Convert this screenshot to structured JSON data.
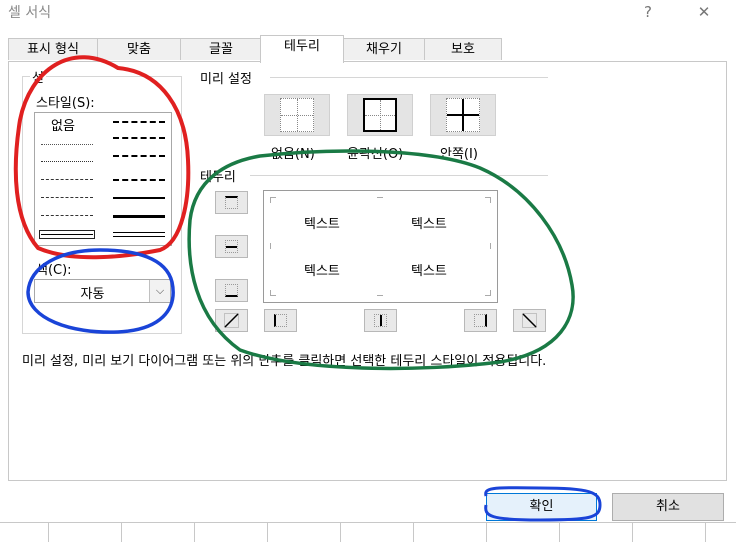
{
  "window": {
    "title": "셀 서식",
    "help_label": "?",
    "close_label": "✕"
  },
  "tabs": [
    {
      "label": "표시 형식"
    },
    {
      "label": "맞춤"
    },
    {
      "label": "글꼴"
    },
    {
      "label": "테두리",
      "active": true
    },
    {
      "label": "채우기"
    },
    {
      "label": "보호"
    }
  ],
  "line_group": {
    "title": "선",
    "style_label": "스타일(S):",
    "none_label": "없음",
    "color_label": "색(C):",
    "color_value": "자동"
  },
  "presets": {
    "title": "미리 설정",
    "items": [
      {
        "label": "없음(N)",
        "icon": "no-border-icon"
      },
      {
        "label": "윤곽선(O)",
        "icon": "outline-border-icon"
      },
      {
        "label": "안쪽(I)",
        "icon": "inside-border-icon"
      }
    ]
  },
  "border": {
    "title": "테두리",
    "preview_text": [
      "텍스트",
      "텍스트",
      "텍스트",
      "텍스트"
    ]
  },
  "info_text": "미리 설정, 미리 보기 다이어그램 또는 위의 단추를 클릭하면 선택한 테두리 스타일이 적용됩니다.",
  "buttons": {
    "ok": "확인",
    "cancel": "취소"
  },
  "annotation_colors": {
    "red": "#e02020",
    "blue": "#1a44d8",
    "green": "#1a7a45"
  }
}
